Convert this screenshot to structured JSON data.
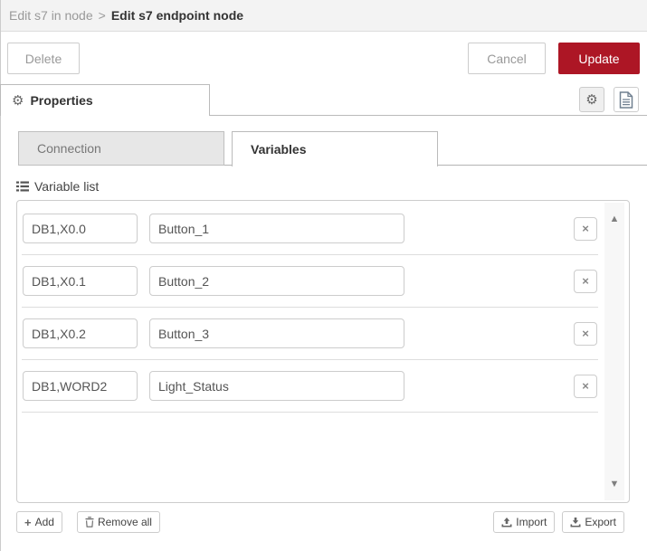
{
  "breadcrumb": {
    "parent": "Edit s7 in node",
    "separator": ">",
    "current": "Edit s7 endpoint node"
  },
  "actions": {
    "delete": "Delete",
    "cancel": "Cancel",
    "update": "Update"
  },
  "properties_tab": {
    "label": "Properties"
  },
  "tabs": [
    {
      "label": "Connection",
      "active": false
    },
    {
      "label": "Variables",
      "active": true
    }
  ],
  "variable_list": {
    "label": "Variable list",
    "columns": [
      "address",
      "name"
    ],
    "rows": [
      {
        "address": "DB1,X0.0",
        "name": "Button_1"
      },
      {
        "address": "DB1,X0.1",
        "name": "Button_2"
      },
      {
        "address": "DB1,X0.2",
        "name": "Button_3"
      },
      {
        "address": "DB1,WORD2",
        "name": "Light_Status"
      }
    ],
    "row_delete_glyph": "×"
  },
  "footer": {
    "add": "Add",
    "remove_all": "Remove all",
    "import": "Import",
    "export": "Export"
  },
  "icons": {
    "properties_tab": "gear",
    "settings_button": "gear",
    "doc_button": "document",
    "variable_list": "list",
    "add": "plus",
    "remove_all": "trash",
    "import": "upload",
    "export": "download",
    "row_delete": "x",
    "gear_glyph": "⚙",
    "plus_glyph": "+",
    "scroll_up_glyph": "▲",
    "scroll_down_glyph": "▼"
  },
  "colors": {
    "accent_red": "#ad1625",
    "header_bg": "#f3f3f3",
    "inactive_tab_bg": "#e7e7e7",
    "border": "#cccccc"
  }
}
